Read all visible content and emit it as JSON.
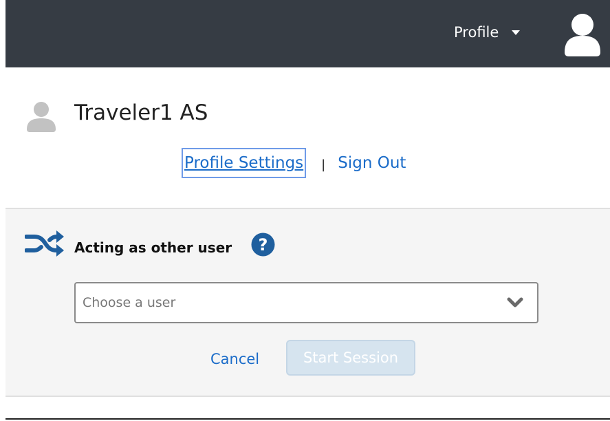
{
  "header": {
    "profile_menu_label": "Profile",
    "profile_menu_icon": "chevron-down-icon",
    "avatar_icon": "user-avatar-icon",
    "background_color": "#363c44"
  },
  "user": {
    "name": "Traveler1 AS",
    "avatar_icon": "user-avatar-icon",
    "links": {
      "profile_settings": "Profile Settings",
      "separator": "|",
      "sign_out": "Sign Out"
    }
  },
  "acting_as": {
    "title": "Acting as other user",
    "title_icon": "shuffle-icon",
    "help_icon": "help-icon",
    "select": {
      "placeholder": "Choose a user",
      "value": ""
    },
    "cancel_label": "Cancel",
    "start_session_label": "Start Session",
    "start_session_enabled": false
  },
  "colors": {
    "link": "#1b6cc9",
    "accent_icon": "#1f5f9e"
  }
}
